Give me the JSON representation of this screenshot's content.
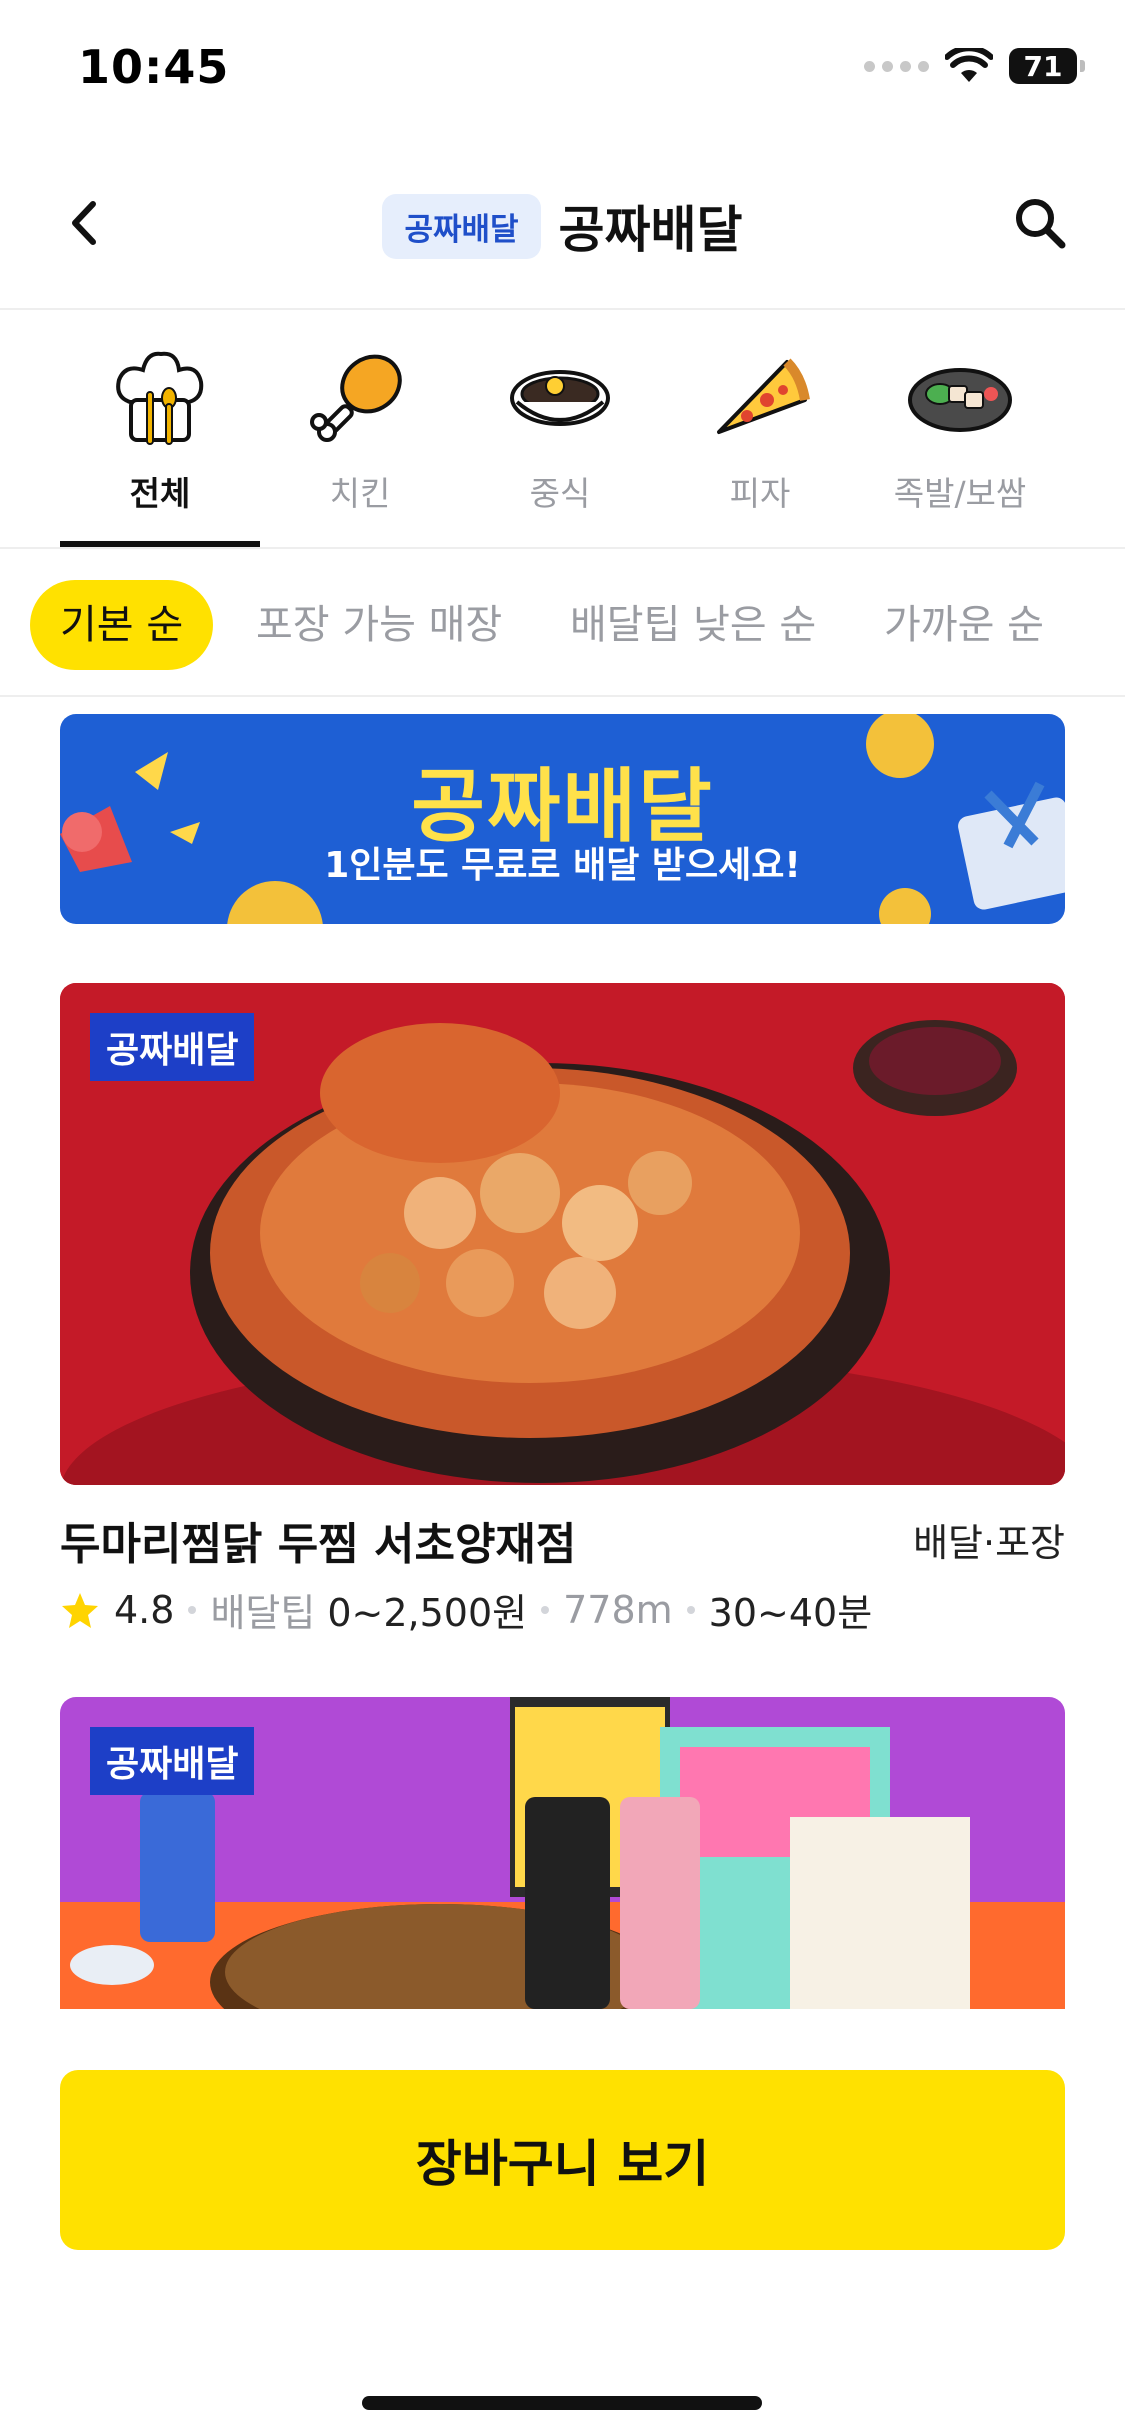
{
  "status_bar": {
    "time": "10:45",
    "battery": "71"
  },
  "header": {
    "badge": "공짜배달",
    "title": "공짜배달"
  },
  "categories": [
    {
      "label": "전체",
      "icon": "chef-hat-icon",
      "active": true
    },
    {
      "label": "치킨",
      "icon": "chicken-leg-icon",
      "active": false
    },
    {
      "label": "중식",
      "icon": "noodle-bowl-icon",
      "active": false
    },
    {
      "label": "피자",
      "icon": "pizza-slice-icon",
      "active": false
    },
    {
      "label": "족발/보쌈",
      "icon": "pork-plate-icon",
      "active": false
    }
  ],
  "sort_options": [
    {
      "label": "기본 순",
      "active": true
    },
    {
      "label": "포장 가능 매장",
      "active": false
    },
    {
      "label": "배달팁 낮은 순",
      "active": false
    },
    {
      "label": "가까운 순",
      "active": false
    }
  ],
  "banner": {
    "title": "공짜배달",
    "subtitle": "1인분도 무료로 배달 받으세요!"
  },
  "stores": [
    {
      "tag": "공짜배달",
      "name": "두마리찜닭 두찜 서초양재점",
      "type": "배달·포장",
      "rating": "4.8",
      "delivery_tip_label": "배달팁",
      "delivery_tip": "0~2,500원",
      "distance": "778m",
      "time": "30~40분"
    },
    {
      "tag": "공짜배달"
    }
  ],
  "cart_button": {
    "label": "장바구니 보기"
  },
  "colors": {
    "accent": "#ffe100",
    "brand_blue": "#1e5fd4",
    "tag_blue": "#1d3fc7",
    "muted": "#9a9ca2"
  }
}
